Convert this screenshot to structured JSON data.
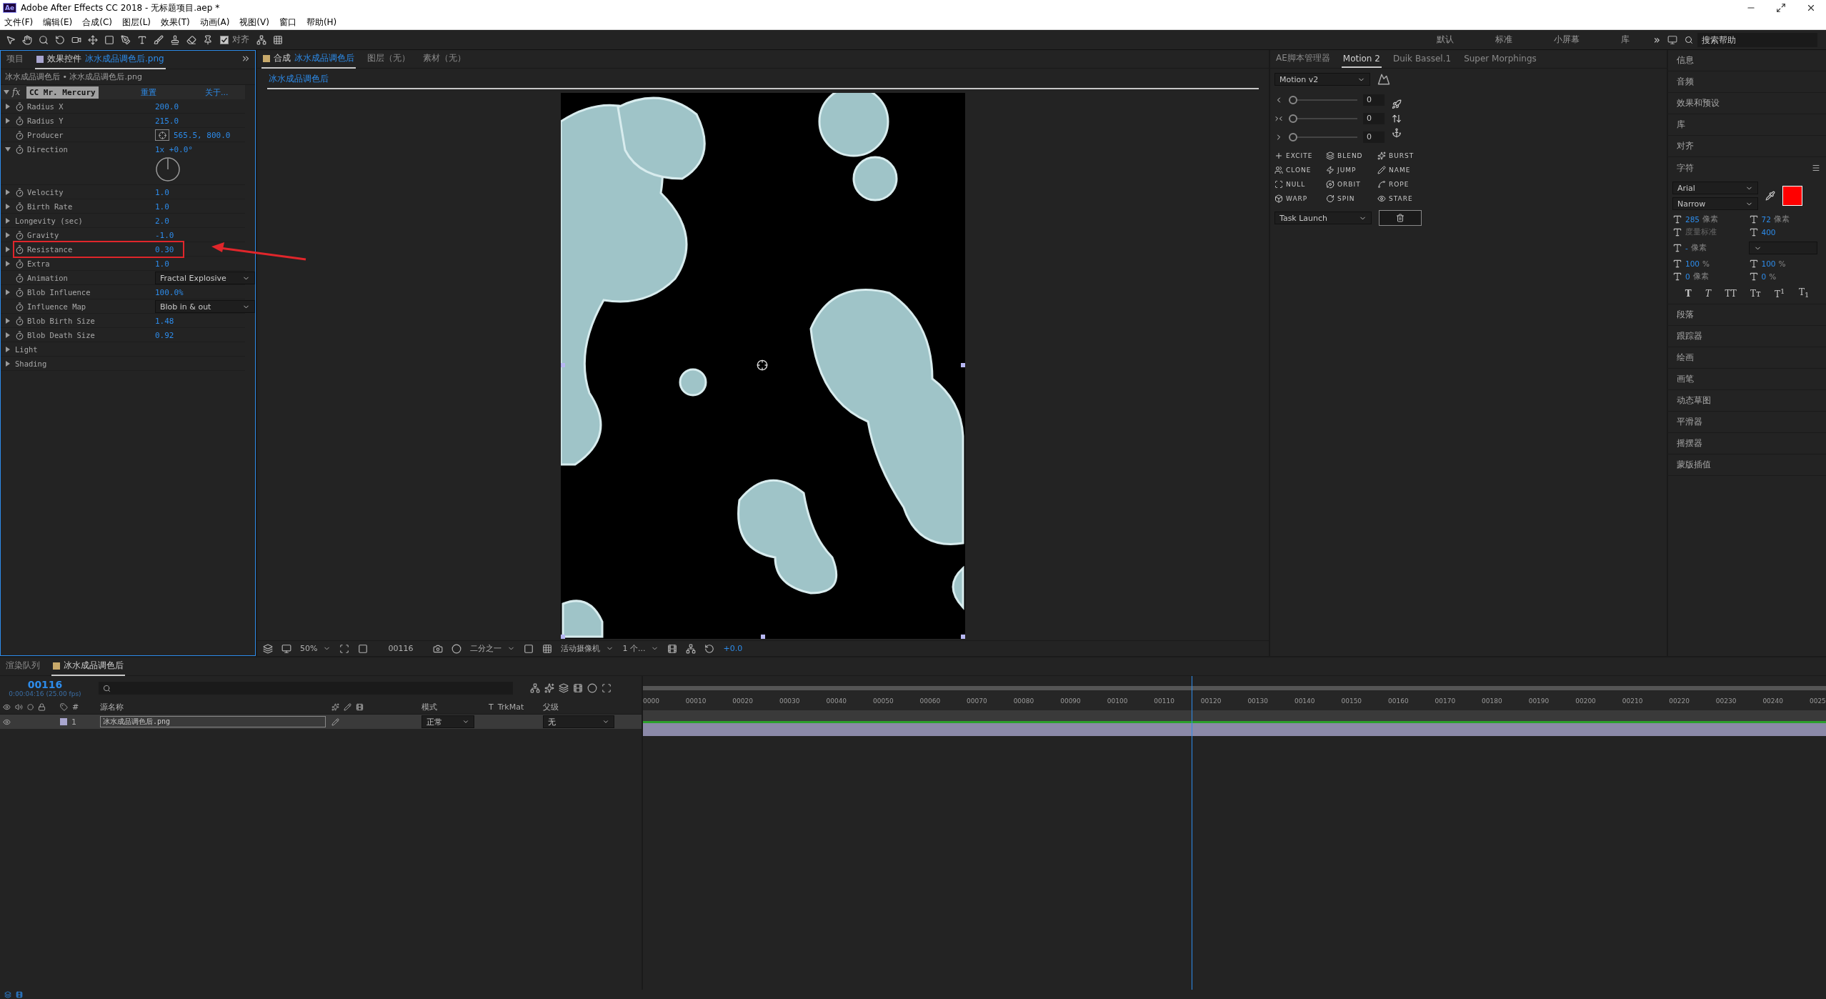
{
  "window": {
    "app_icon": "Ae",
    "title": "Adobe After Effects CC 2018 - 无标题项目.aep *"
  },
  "menu": [
    "文件(F)",
    "编辑(E)",
    "合成(C)",
    "图层(L)",
    "效果(T)",
    "动画(A)",
    "视图(V)",
    "窗口",
    "帮助(H)"
  ],
  "toolbar": {
    "align": {
      "label": "对齐",
      "checked": true
    },
    "workspaces": [
      "默认",
      "标准",
      "小屏幕",
      "库"
    ],
    "overflow": "»",
    "search": {
      "placeholder": "搜索帮助"
    }
  },
  "effect_controls": {
    "tabs": [
      {
        "label": "项目",
        "selected": false
      },
      {
        "label": "效果控件",
        "file": "冰水成品调色后.png",
        "selected": true
      }
    ],
    "breadcrumb": "冰水成品调色后 • 冰水成品调色后.png",
    "effect": {
      "fx_label": "fx",
      "expanded": true,
      "name": "CC Mr. Mercury",
      "reset": "重置",
      "about": "关于..."
    },
    "properties": [
      {
        "kind": "value",
        "name": "Radius X",
        "value": "200.0",
        "twirl": true,
        "expanded": false,
        "stopwatch": true,
        "highlighted": false
      },
      {
        "kind": "value",
        "name": "Radius Y",
        "value": "215.0",
        "twirl": true,
        "expanded": false,
        "stopwatch": true,
        "highlighted": false
      },
      {
        "kind": "point",
        "name": "Producer",
        "value": "565.5, 800.0",
        "twirl": false,
        "stopwatch": true,
        "highlighted": false
      },
      {
        "kind": "angle",
        "name": "Direction",
        "value": "1x +0.0°",
        "twirl": true,
        "expanded": true,
        "stopwatch": true,
        "highlighted": false
      },
      {
        "kind": "value",
        "name": "Velocity",
        "value": "1.0",
        "twirl": true,
        "expanded": false,
        "stopwatch": true,
        "highlighted": false
      },
      {
        "kind": "value",
        "name": "Birth Rate",
        "value": "1.0",
        "twirl": true,
        "expanded": false,
        "stopwatch": true,
        "highlighted": false
      },
      {
        "kind": "value",
        "name": "Longevity (sec)",
        "value": "2.0",
        "twirl": true,
        "expanded": false,
        "stopwatch": false,
        "highlighted": false
      },
      {
        "kind": "value",
        "name": "Gravity",
        "value": "-1.0",
        "twirl": true,
        "expanded": false,
        "stopwatch": true,
        "highlighted": false
      },
      {
        "kind": "value",
        "name": "Resistance",
        "value": "0.30",
        "twirl": true,
        "expanded": false,
        "stopwatch": true,
        "highlighted": true
      },
      {
        "kind": "value",
        "name": "Extra",
        "value": "1.0",
        "twirl": true,
        "expanded": false,
        "stopwatch": true,
        "highlighted": false
      },
      {
        "kind": "dropdown",
        "name": "Animation",
        "value": "Fractal Explosive",
        "twirl": false,
        "stopwatch": true,
        "highlighted": false
      },
      {
        "kind": "value",
        "name": "Blob Influence",
        "value": "100.0%",
        "twirl": true,
        "expanded": false,
        "stopwatch": true,
        "highlighted": false
      },
      {
        "kind": "dropdown",
        "name": "Influence Map",
        "value": "Blob in & out",
        "twirl": false,
        "stopwatch": true,
        "highlighted": false
      },
      {
        "kind": "value",
        "name": "Blob Birth Size",
        "value": "1.48",
        "twirl": true,
        "expanded": false,
        "stopwatch": true,
        "highlighted": false
      },
      {
        "kind": "value",
        "name": "Blob Death Size",
        "value": "0.92",
        "twirl": true,
        "expanded": false,
        "stopwatch": true,
        "highlighted": false
      },
      {
        "kind": "group",
        "name": "Light",
        "twirl": true,
        "expanded": false,
        "stopwatch": false,
        "highlighted": false
      },
      {
        "kind": "group",
        "name": "Shading",
        "twirl": true,
        "expanded": false,
        "stopwatch": false,
        "highlighted": false
      }
    ]
  },
  "viewer": {
    "tabs": [
      {
        "label": "合成",
        "comp": "冰水成品调色后",
        "selected": true
      },
      {
        "label": "图层（无）",
        "selected": false
      },
      {
        "label": "素材（无）",
        "selected": false
      }
    ],
    "comp_tab": "冰水成品调色后",
    "footer": {
      "zoom": "50%",
      "timecode": "00116",
      "resolution": "二分之一",
      "camera": "活动摄像机",
      "views": "1 个...",
      "exposure": "+0.0"
    }
  },
  "motion_panel": {
    "tabs": [
      {
        "label": "AE脚本管理器",
        "selected": false
      },
      {
        "label": "Motion 2",
        "selected": true
      },
      {
        "label": "Duik Bassel.1",
        "selected": false
      },
      {
        "label": "Super Morphings",
        "selected": false
      }
    ],
    "preset": "Motion v2",
    "sliders": [
      {
        "value": "0",
        "level": 0
      },
      {
        "value": "0",
        "level": 0
      },
      {
        "value": "0",
        "level": 0
      }
    ],
    "buttons": [
      "EXCITE",
      "BLEND",
      "BURST",
      "CLONE",
      "JUMP",
      "NAME",
      "NULL",
      "ORBIT",
      "ROPE",
      "WARP",
      "SPIN",
      "STARE"
    ],
    "task": "Task Launch"
  },
  "side_panels": {
    "above": [
      "信息",
      "音频",
      "效果和预设",
      "库",
      "对齐"
    ],
    "character": {
      "title": "字符",
      "font": "Arial",
      "style": "Narrow",
      "fill": {
        "color": "#ff0000"
      },
      "size": {
        "value": "285",
        "unit": "像素"
      },
      "leading": {
        "value": "72",
        "unit": "像素"
      },
      "kerning": {
        "value": "度量标准",
        "disabled": true
      },
      "tracking": {
        "value": "400"
      },
      "stroke": {
        "value": "-",
        "unit": "像素"
      },
      "vertical_scale": {
        "value": "100",
        "unit": "%"
      },
      "horizontal_scale": {
        "value": "100",
        "unit": "%"
      },
      "baseline_shift": {
        "value": "0",
        "unit": "像素"
      },
      "tsume": {
        "value": "0",
        "unit": "%"
      },
      "style_buttons": [
        "T",
        "T",
        "TT",
        "Tт",
        "T$^{1}$",
        "T$_{1}$"
      ]
    },
    "below": [
      "段落",
      "跟踪器",
      "绘画",
      "画笔",
      "动态草图",
      "平滑器",
      "摇摆器",
      "蒙版插值"
    ]
  },
  "timeline": {
    "tabs": [
      {
        "label": "渲染队列",
        "selected": false
      },
      {
        "label": "冰水成品调色后",
        "selected": true
      }
    ],
    "timecode": "00116",
    "timecode_detail": "0:00:04:16 (25.00 fps)",
    "columns": {
      "number": "#",
      "source_name": "源名称",
      "mode": "模式",
      "t": "T",
      "trkmat": "TrkMat",
      "parent": "父级"
    },
    "layers": [
      {
        "number": "1",
        "name": "冰水成品调色后.png",
        "mode": "正常",
        "parent": "无",
        "selected": true
      }
    ],
    "ruler": [
      "0000",
      "00010",
      "00020",
      "00030",
      "00040",
      "00050",
      "00060",
      "00070",
      "00080",
      "00090",
      "00100",
      "00110",
      "00120",
      "00130",
      "00140",
      "00150",
      "00160",
      "00170",
      "00180",
      "00190",
      "00200",
      "00210",
      "00220",
      "00230",
      "00240",
      "0025"
    ],
    "playhead": {
      "level": 0.464
    }
  }
}
